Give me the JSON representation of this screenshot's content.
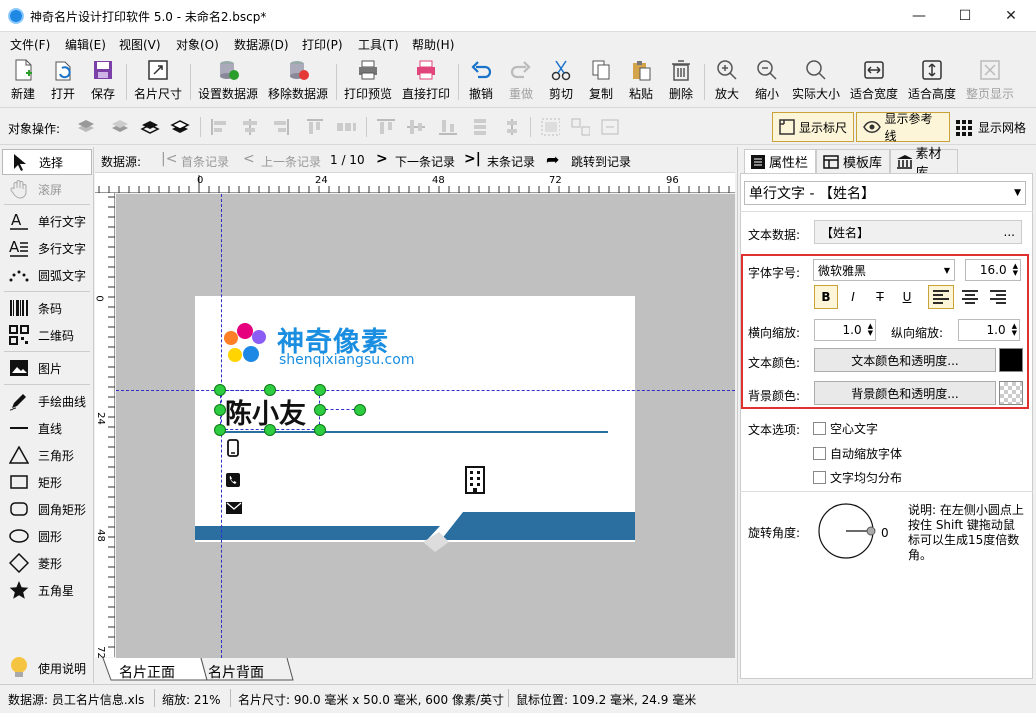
{
  "window": {
    "title": "神奇名片设计打印软件 5.0 - 未命名2.bscp*",
    "minimize": "—",
    "maximize": "☐",
    "close": "✕"
  },
  "menu": [
    "文件(F)",
    "编辑(E)",
    "视图(V)",
    "对象(O)",
    "数据源(D)",
    "打印(P)",
    "工具(T)",
    "帮助(H)"
  ],
  "toolbar": {
    "new": "新建",
    "open": "打开",
    "save": "保存",
    "card_size": "名片尺寸",
    "set_datasource": "设置数据源",
    "remove_datasource": "移除数据源",
    "print_preview": "打印预览",
    "direct_print": "直接打印",
    "undo": "撤销",
    "redo": "重做",
    "cut": "剪切",
    "copy": "复制",
    "paste": "粘贴",
    "delete": "删除",
    "zoom_in": "放大",
    "zoom_out": "缩小",
    "actual_size": "实际大小",
    "fit_width": "适合宽度",
    "fit_height": "适合高度",
    "full_page": "整页显示"
  },
  "objbar": {
    "label": "对象操作:",
    "show_ruler": "显示标尺",
    "show_guides": "显示参考线",
    "show_grid": "显示网格"
  },
  "tools": {
    "select": "选择",
    "scroll": "滚屏",
    "single_text": "单行文字",
    "multi_text": "多行文字",
    "arc_text": "圆弧文字",
    "barcode": "条码",
    "qrcode": "二维码",
    "image": "图片",
    "freehand": "手绘曲线",
    "line": "直线",
    "triangle": "三角形",
    "rect": "矩形",
    "round_rect": "圆角矩形",
    "circle": "圆形",
    "diamond": "菱形",
    "star": "五角星",
    "help": "使用说明"
  },
  "nav": {
    "label": "数据源:",
    "first": "首条记录",
    "prev": "上一条记录",
    "counter": "1 / 10",
    "next": "下一条记录",
    "last": "末条记录",
    "goto": "跳转到记录"
  },
  "ruler": {
    "top": [
      "0",
      "24",
      "48",
      "72",
      "96"
    ],
    "left": [
      "0",
      "24",
      "48",
      "72"
    ]
  },
  "card": {
    "brand_cn": "神奇像素",
    "brand_en": "shenqixiangsu.com",
    "name": "陈小友",
    "brand_color": "#1a8ee0",
    "band_color": "#2a6fa0"
  },
  "page_tabs": [
    "名片正面",
    "名片背面"
  ],
  "panel": {
    "tabs": [
      "属性栏",
      "模板库",
      "素材库"
    ],
    "object_combo": "单行文字 - 【姓名】",
    "text_data_label": "文本数据:",
    "text_data_value": "【姓名】",
    "ellipsis": "...",
    "font_label": "字体字号:",
    "font_name": "微软雅黑",
    "font_size": "16.0",
    "bold": "B",
    "italic": "I",
    "strike": "T",
    "underline": "U",
    "hscale_label": "横向缩放:",
    "hscale": "1.0",
    "vscale_label": "纵向缩放:",
    "vscale": "1.0",
    "text_color_label": "文本颜色:",
    "text_color_btn": "文本颜色和透明度...",
    "bg_color_label": "背景颜色:",
    "bg_color_btn": "背景颜色和透明度...",
    "options_label": "文本选项:",
    "opt_hollow": "空心文字",
    "opt_autoscale": "自动缩放字体",
    "opt_distribute": "文字均匀分布",
    "rotate_label": "旋转角度:",
    "rotate_value": "0",
    "note": "说明: 在左侧小圆点上按住 Shift 键拖动鼠标可以生成15度倍数角。"
  },
  "status": {
    "datasource": "数据源: 员工名片信息.xls",
    "zoom": "缩放: 21%",
    "card_size": "名片尺寸: 90.0 毫米 x 50.0 毫米, 600 像素/英寸",
    "mouse": "鼠标位置: 109.2 毫米, 24.9 毫米"
  }
}
